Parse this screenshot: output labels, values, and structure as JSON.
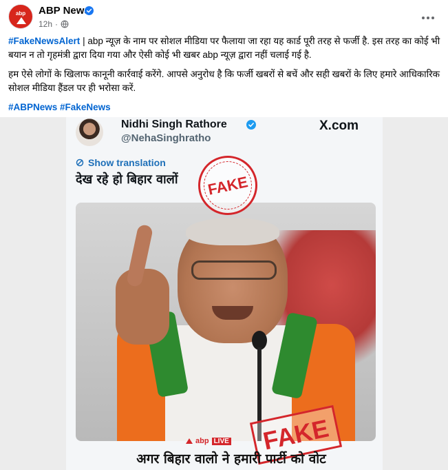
{
  "page": {
    "name": "ABP News",
    "timestamp": "12h",
    "separator": "·",
    "avatar_text": "abp"
  },
  "post": {
    "hashtag_alert": "#FakeNewsAlert",
    "paragraph1": " | abp न्यूज़ के नाम पर सोशल मीडिया पर फैलाया जा रहा यह कार्ड पूरी तरह से फर्जी है. इस तरह का कोई भी बयान न तो गृहमंत्री द्वारा दिया गया और ऐसी कोई भी खबर abp न्यूज़ द्वारा नहीं चलाई गई है.",
    "paragraph2": "हम ऐसे लोगों के खिलाफ कानूनी कार्रवाई करेंगे. आपसे अनुरोध है कि फर्जी खबरों से बचें और सही खबरों के लिए हमारे आधिकारिक सोशल मीडिया हैंडल पर ही भरोसा करें.",
    "hashtags": [
      "#ABPNews",
      "#FakeNews"
    ]
  },
  "image": {
    "tweet_name": "Nidhi Singh Rathore",
    "tweet_handle": "@NehaSinghratho",
    "platform": "X.com",
    "show_translation": "Show translation",
    "tweet_text": "देख रहे हो बिहार वालों",
    "stamp_top": "FAKE",
    "stamp_bottom": "FAKE",
    "abp_label": "abp",
    "live_label": "LIVE",
    "caption": "अगर बिहार वालो ने हमारी पार्टी को वोट"
  },
  "colors": {
    "link": "#0064d1",
    "stamp": "#d4262b",
    "brand": "#d7261c",
    "verified": "#1877f2"
  },
  "icons": {
    "verified": "verified-badge-icon",
    "privacy": "globe-icon",
    "more": "more-options-icon",
    "translate": "translate-icon"
  }
}
